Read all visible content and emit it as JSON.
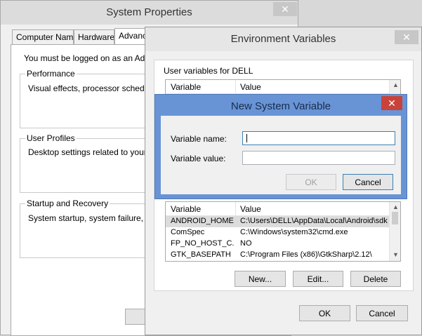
{
  "system_properties": {
    "title": "System Properties",
    "tabs": [
      "Computer Name",
      "Hardware",
      "Advanced"
    ],
    "admin_note": "You must be logged on as an Administrator to make most of these changes.",
    "performance": {
      "title": "Performance",
      "text": "Visual effects, processor scheduling, memory usage, and virtual memory"
    },
    "user_profiles": {
      "title": "User Profiles",
      "text": "Desktop settings related to your sign-in"
    },
    "startup": {
      "title": "Startup and Recovery",
      "text": "System startup, system failure, and debugging information"
    }
  },
  "env_vars": {
    "title": "Environment Variables",
    "user_group_label": "User variables for DELL",
    "user_columns": [
      "Variable",
      "Value"
    ],
    "system_columns": [
      "Variable",
      "Value"
    ],
    "system_rows": [
      {
        "variable": "ANDROID_HOME",
        "value": "C:\\Users\\DELL\\AppData\\Local\\Android\\sdk"
      },
      {
        "variable": "ComSpec",
        "value": "C:\\Windows\\system32\\cmd.exe"
      },
      {
        "variable": "FP_NO_HOST_C...",
        "value": "NO"
      },
      {
        "variable": "GTK_BASEPATH",
        "value": "C:\\Program Files (x86)\\GtkSharp\\2.12\\"
      }
    ],
    "new_label": "New...",
    "edit_label": "Edit...",
    "delete_label": "Delete",
    "ok_label": "OK",
    "cancel_label": "Cancel"
  },
  "new_var_dialog": {
    "title": "New System Variable",
    "name_label": "Variable name:",
    "value_label": "Variable value:",
    "name_value": "",
    "value_value": "",
    "ok_label": "OK",
    "cancel_label": "Cancel"
  },
  "colors": {
    "dialog_frame": "#6894d6",
    "close_active": "#c9433a",
    "default_button_border": "#3c7fb1"
  },
  "icons": {
    "close": "close-icon",
    "scroll_up": "chevron-up-icon",
    "scroll_down": "chevron-down-icon"
  }
}
